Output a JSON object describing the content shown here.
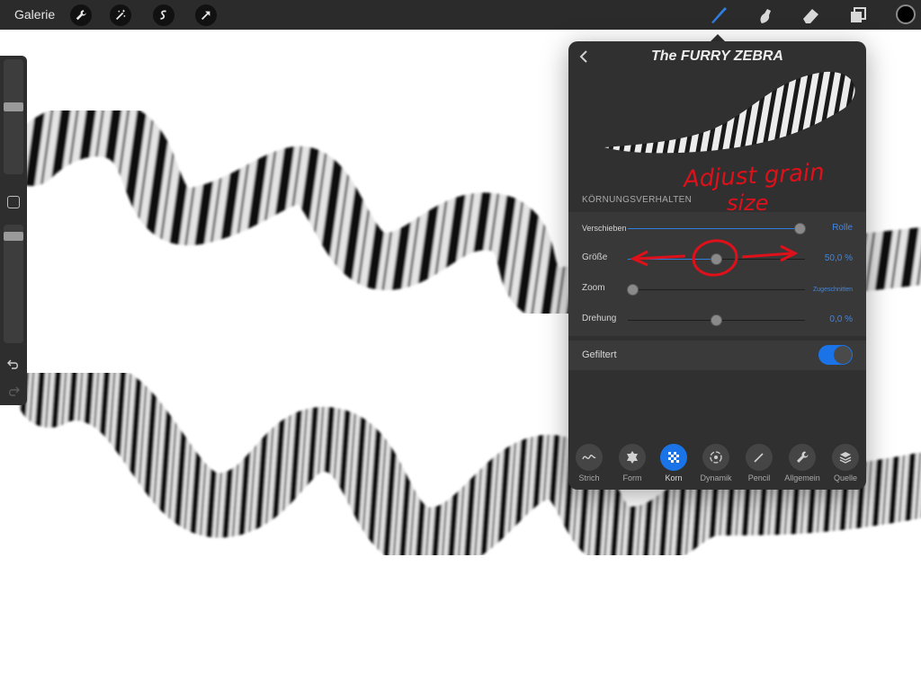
{
  "topbar": {
    "gallery_label": "Galerie",
    "left_tools": [
      {
        "icon": "wrench-icon"
      },
      {
        "icon": "magic-wand-icon"
      },
      {
        "icon": "selection-icon"
      },
      {
        "icon": "transform-arrow-icon"
      }
    ],
    "right_tools": [
      {
        "icon": "brush-icon",
        "active": true
      },
      {
        "icon": "smudge-icon"
      },
      {
        "icon": "eraser-icon"
      },
      {
        "icon": "layers-icon"
      }
    ],
    "active_color": "#000000",
    "accent": "#2f7fe0"
  },
  "sidebar": {
    "brush_size_level": 0.17,
    "opacity_level": 0.05,
    "icons": [
      "undo-icon",
      "redo-icon"
    ]
  },
  "brush_panel": {
    "title": "The FURRY ZEBRA",
    "section_label": "KÖRNUNGSVERHALTEN",
    "rows": [
      {
        "label": "Verschieben",
        "value": "Rolle",
        "level": 0.97
      },
      {
        "label": "Größe",
        "value": "50,0 %",
        "level": 0.5
      },
      {
        "label": "Zoom",
        "value": "Zugeschnitten",
        "level": 0.0
      },
      {
        "label": "Drehung",
        "value": "0,0 %",
        "level": 0.5
      }
    ],
    "filter": {
      "label": "Gefiltert",
      "on": true
    },
    "tabs": [
      {
        "label": "Strich",
        "icon": "stroke-path-icon",
        "active": false
      },
      {
        "label": "Form",
        "icon": "shape-icon",
        "active": false
      },
      {
        "label": "Korn",
        "icon": "grain-icon",
        "active": true
      },
      {
        "label": "Dynamik",
        "icon": "dynamics-icon",
        "active": false
      },
      {
        "label": "Pencil",
        "icon": "pencil-icon",
        "active": false
      },
      {
        "label": "Allgemein",
        "icon": "wrench-icon",
        "active": false
      },
      {
        "label": "Quelle",
        "icon": "source-layers-icon",
        "active": false
      }
    ]
  },
  "annotation": {
    "line1": "Adjust grain",
    "line2": "size",
    "color": "#e0101a"
  }
}
